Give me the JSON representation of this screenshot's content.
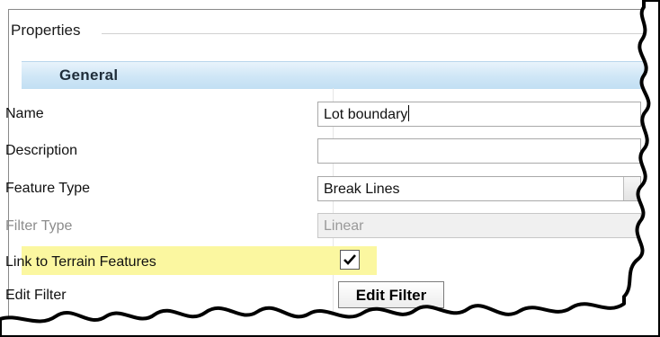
{
  "panel": {
    "title": "Properties"
  },
  "section": {
    "title": "General"
  },
  "rows": [
    {
      "label": "Name",
      "value": "Lot boundary"
    },
    {
      "label": "Description",
      "value": ""
    },
    {
      "label": "Feature Type",
      "value": "Break Lines"
    },
    {
      "label": "Filter Type",
      "value": "Linear"
    },
    {
      "label": "Link to Terrain Features",
      "checked": true
    },
    {
      "label": "Edit Filter",
      "button": "Edit Filter"
    }
  ],
  "colors": {
    "highlight": "#fbf7a0",
    "section_bg": "#cfe6f6"
  },
  "icons": {
    "checkbox": "checkmark-icon",
    "combo": "dropdown-button"
  }
}
